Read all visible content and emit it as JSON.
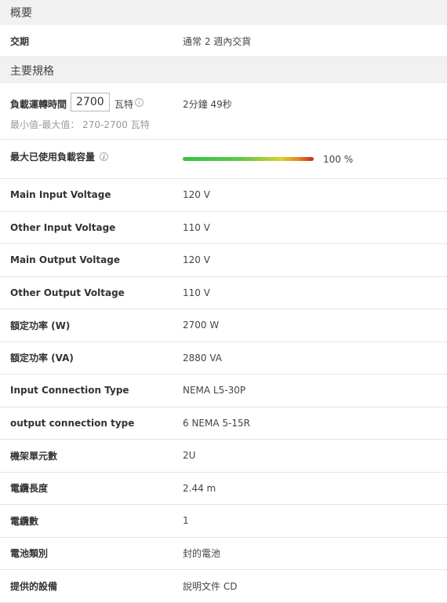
{
  "overview": {
    "title": "概要",
    "delivery_label": "交期",
    "delivery_value": "通常 2 週內交貨"
  },
  "specs": {
    "title": "主要規格",
    "runtime": {
      "label": "負載運轉時間",
      "input_value": "2700",
      "unit": "瓦特",
      "range_hint": "最小值-最大值： 270-2700 瓦特",
      "result": "2分鐘 49秒"
    },
    "max_load": {
      "label": "最大已使用負載容量",
      "percent_text": "100 %",
      "fill_percent": 100
    },
    "rows": [
      {
        "label": "Main Input Voltage",
        "value": "120 V"
      },
      {
        "label": "Other Input Voltage",
        "value": "110 V"
      },
      {
        "label": "Main Output Voltage",
        "value": "120 V"
      },
      {
        "label": "Other Output Voltage",
        "value": "110 V"
      },
      {
        "label": "額定功率 (W)",
        "value": "2700 W"
      },
      {
        "label": "額定功率 (VA)",
        "value": "2880 VA"
      },
      {
        "label": "Input Connection Type",
        "value": "NEMA L5-30P"
      },
      {
        "label": "output connection type",
        "value": "6 NEMA 5-15R"
      },
      {
        "label": "機架單元數",
        "value": "2U"
      },
      {
        "label": "電纜長度",
        "value": "2.44 m"
      },
      {
        "label": "電纜數",
        "value": "1"
      },
      {
        "label": "電池類別",
        "value": "封的電池"
      },
      {
        "label": "提供的設備",
        "value": "說明文件 CD"
      }
    ]
  },
  "icons": {
    "info": "info-icon"
  },
  "colors": {
    "section_header_bg": "#f1f1f1",
    "bar_start": "#35c24a",
    "bar_mid": "#d8d22a",
    "bar_end": "#c8262b"
  }
}
